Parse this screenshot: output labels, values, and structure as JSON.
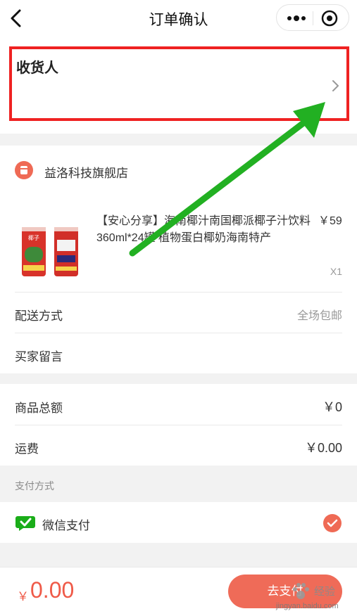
{
  "nav": {
    "title": "订单确认",
    "back_icon": "chevron-left-icon",
    "more_icon": "more-dots-icon",
    "target_icon": "close-circle-icon"
  },
  "consignee": {
    "label": "收货人",
    "highlight_color": "#ef2222"
  },
  "store": {
    "name": "益洛科技旗舰店",
    "product": {
      "title": "【安心分享】海南椰汁南国椰派椰子汁饮料 360ml*24罐 植物蛋白椰奶海南特产",
      "price": "￥59",
      "qty": "X1",
      "can_text": "椰子"
    },
    "delivery_label": "配送方式",
    "delivery_value": "全场包邮",
    "message_label": "买家留言"
  },
  "totals": {
    "goods_label": "商品总额",
    "goods_value": "￥0",
    "shipping_label": "运费",
    "shipping_value": "￥0.00"
  },
  "payment": {
    "section_label": "支付方式",
    "method": "微信支付",
    "accent": "#ef6a55",
    "wechat_color": "#1aad19"
  },
  "footer": {
    "currency": "￥",
    "amount": "0.00",
    "pay_button": "去支付"
  },
  "watermark": {
    "text": "经验",
    "site": "jingyan.baidu.com"
  },
  "annotation": {
    "arrow_color": "#22b022"
  }
}
